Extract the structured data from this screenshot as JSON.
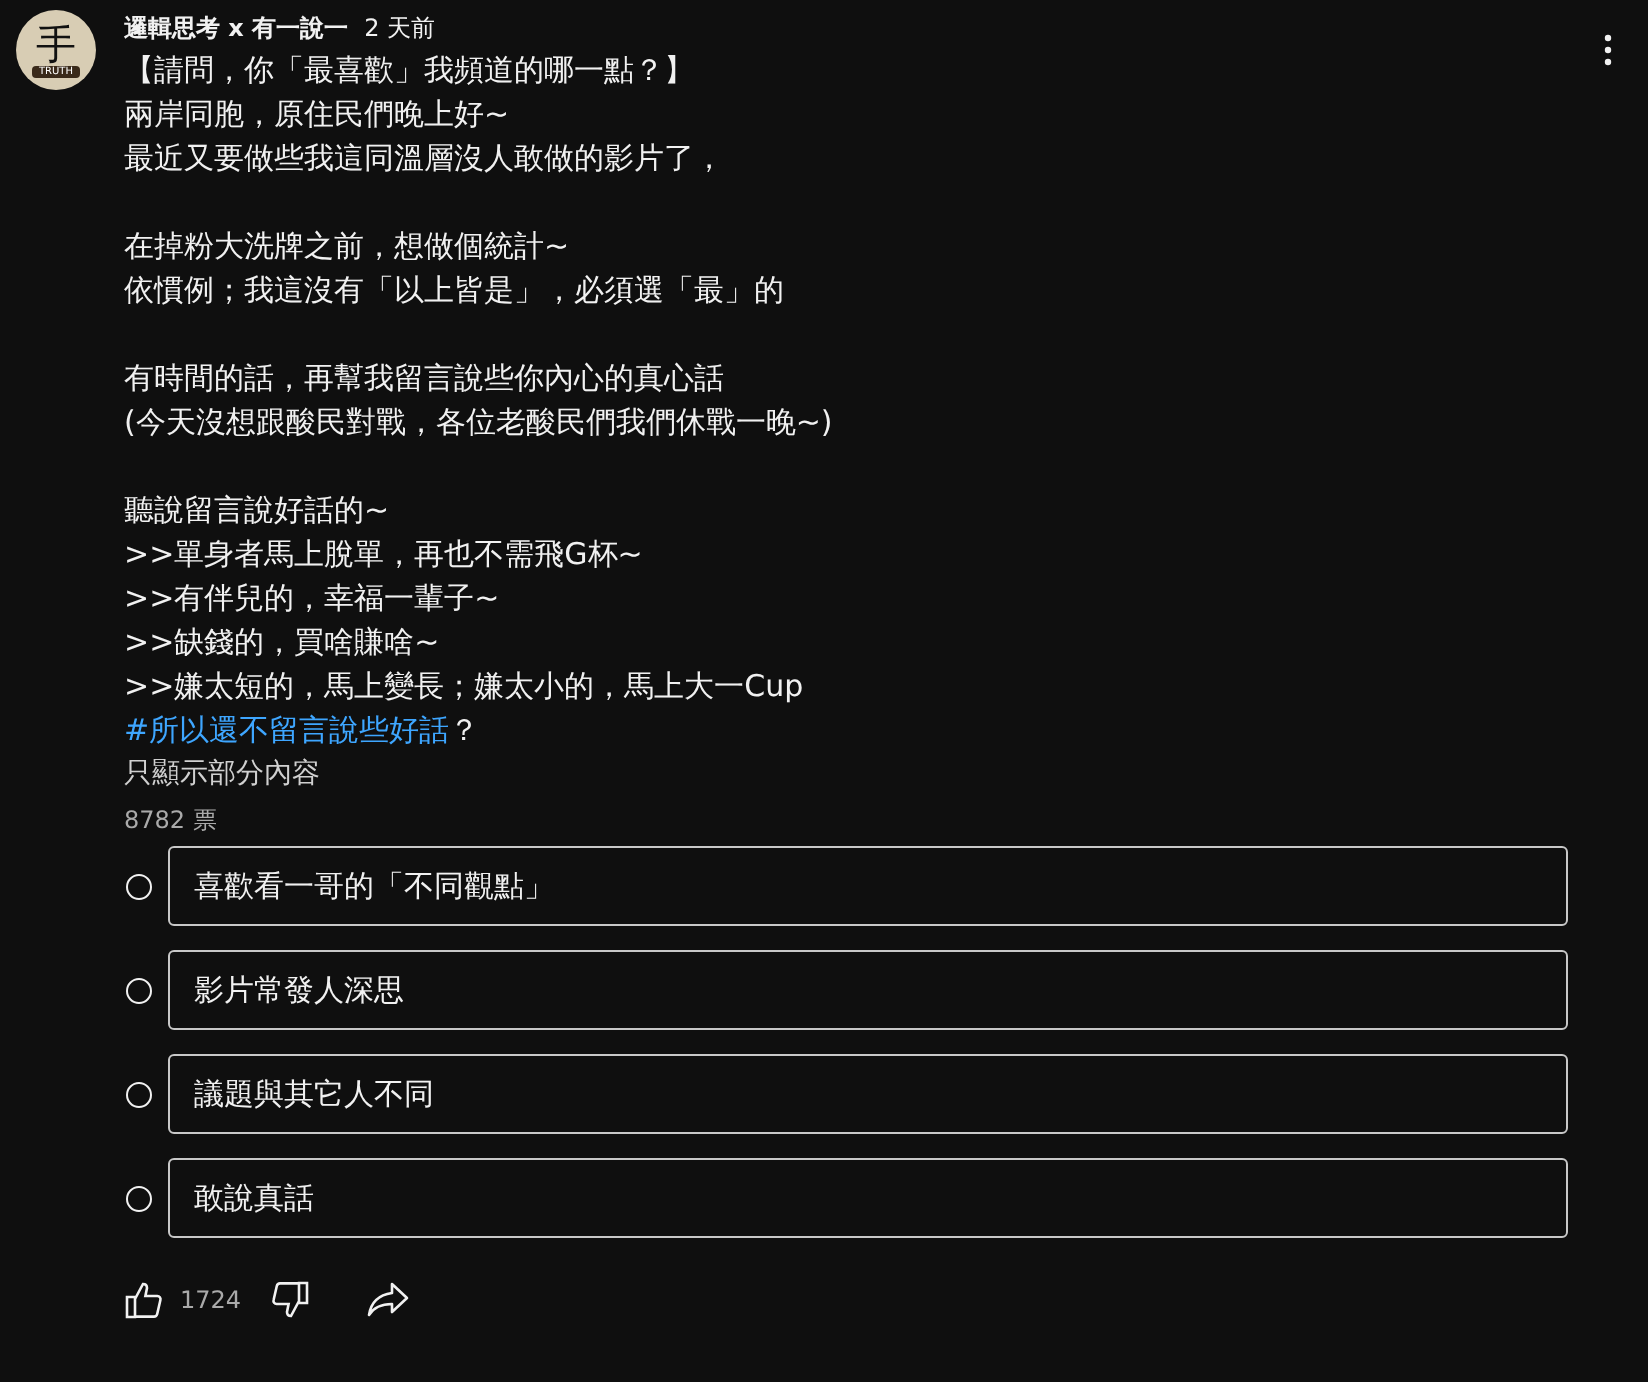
{
  "post": {
    "avatar": {
      "glyph": "手",
      "caption": "TRUTH"
    },
    "author": "邏輯思考 x 有一說一",
    "time": "2 天前",
    "paragraphs": [
      [
        "【請問，你「最喜歡」我頻道的哪一點？】",
        "兩岸同胞，原住民們晚上好~",
        "最近又要做些我這同溫層沒人敢做的影片了，"
      ],
      [
        "在掉粉大洗牌之前，想做個統計~",
        "依慣例；我這沒有「以上皆是」，必須選「最」的"
      ],
      [
        "有時間的話，再幫我留言說些你內心的真心話",
        "(今天沒想跟酸民對戰，各位老酸民們我們休戰一晚~)"
      ],
      [
        "聽說留言說好話的~",
        ">>單身者馬上脫單，再也不需飛G杯~",
        ">>有伴兒的，幸福一輩子~",
        ">>缺錢的，買啥賺啥~",
        ">>嫌太短的，馬上變長；嫌太小的，馬上大一Cup"
      ]
    ],
    "hashtag": {
      "tag": "#所以還不留言說些好話",
      "rest": "？"
    },
    "read_more": "只顯示部分內容",
    "votes": "8782 票",
    "options": [
      {
        "label": "喜歡看一哥的「不同觀點」",
        "selected": false
      },
      {
        "label": "影片常發人深思",
        "selected": false
      },
      {
        "label": "議題與其它人不同",
        "selected": false
      },
      {
        "label": "敢說真話",
        "selected": false
      }
    ],
    "likes": "1724"
  }
}
